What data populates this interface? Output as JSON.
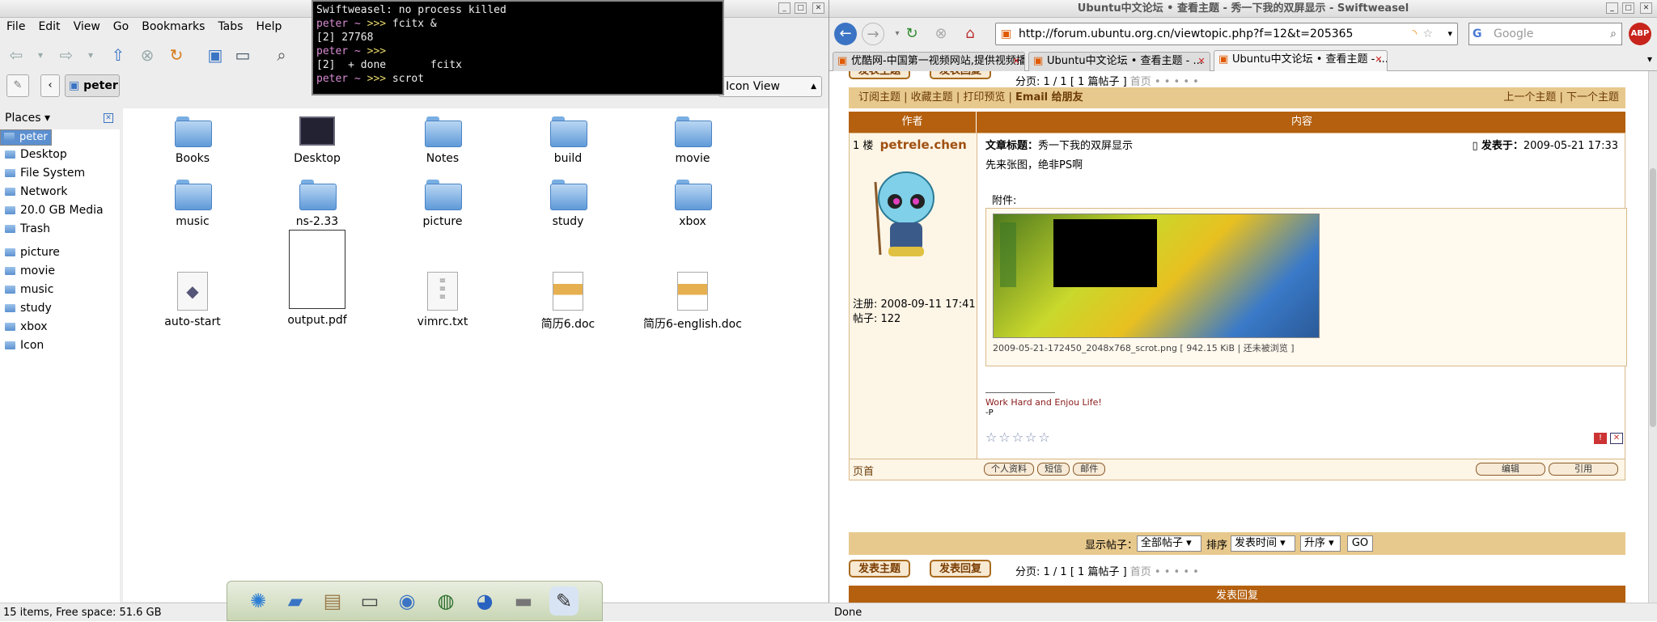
{
  "file_manager": {
    "menu": [
      "File",
      "Edit",
      "View",
      "Go",
      "Bookmarks",
      "Tabs",
      "Help"
    ],
    "location": "peter",
    "view_mode": "Icon View",
    "places_label": "Places",
    "places": [
      {
        "label": "peter",
        "selected": true
      },
      {
        "label": "Desktop"
      },
      {
        "label": "File System"
      },
      {
        "label": "Network"
      },
      {
        "label": "20.0 GB Media"
      },
      {
        "label": "Trash"
      }
    ],
    "bookmarks": [
      "picture",
      "movie",
      "music",
      "study",
      "xbox",
      "Icon"
    ],
    "items": [
      {
        "name": "Books",
        "type": "folder"
      },
      {
        "name": "Desktop",
        "type": "desktop"
      },
      {
        "name": "Notes",
        "type": "folder"
      },
      {
        "name": "build",
        "type": "folder"
      },
      {
        "name": "movie",
        "type": "folder"
      },
      {
        "name": "music",
        "type": "folder"
      },
      {
        "name": "ns-2.33",
        "type": "folder"
      },
      {
        "name": "picture",
        "type": "folder"
      },
      {
        "name": "study",
        "type": "folder"
      },
      {
        "name": "xbox",
        "type": "folder"
      },
      {
        "name": "auto-start",
        "type": "script"
      },
      {
        "name": "output.pdf",
        "type": "pdf"
      },
      {
        "name": "vimrc.txt",
        "type": "text"
      },
      {
        "name": "简历6.doc",
        "type": "doc"
      },
      {
        "name": "简历6-english.doc",
        "type": "doc"
      }
    ],
    "status": "15 items, Free space: 51.6 GB"
  },
  "terminal": {
    "lines": [
      {
        "text": "Swiftweasel: no process killed"
      },
      {
        "prompt": "peter ~ ",
        "arrows": ">>>",
        "cmd": " fcitx &"
      },
      {
        "text": "[2] 27768"
      },
      {
        "prompt": "peter ~ ",
        "arrows": ">>>",
        "cmd": ""
      },
      {
        "text": "[2]  + done       fcitx"
      },
      {
        "prompt": "peter ~ ",
        "arrows": ">>>",
        "cmd": " scrot"
      }
    ]
  },
  "browser": {
    "title": "Ubuntu中文论坛 • 查看主题 - 秀一下我的双屏显示 - Swiftweasel",
    "url": "http://forum.ubuntu.org.cn/viewtopic.php?f=12&t=205365",
    "search_placeholder": "Google",
    "tabs": [
      {
        "label": "优酷网-中国第一视频网站,提供视频播..."
      },
      {
        "label": "Ubuntu中文论坛 • 查看主题 - ..."
      },
      {
        "label": "Ubuntu中文论坛 • 查看主题 - ...",
        "active": true
      }
    ],
    "status": "Done",
    "forum": {
      "new_topic": "发表主题",
      "reply": "发表回复",
      "pagination": "分页: 1 / 1 [ 1 篇帖子 ]",
      "first_page": "首页",
      "topic_links": [
        "订阅主题",
        "收藏主题",
        "打印预览",
        "Email 给朋友"
      ],
      "prev_topic": "上一个主题",
      "next_topic": "下一个主题",
      "col_author": "作者",
      "col_content": "内容",
      "floor": "1 楼",
      "author": "petrele.chen",
      "subject_label": "文章标题：",
      "subject": "秀一下我的双屏显示",
      "posted_label": "发表于：",
      "posted": "2009-05-21 17:33",
      "body": "先来张图，绝非PS啊",
      "attachment_label": "附件:",
      "attachment_caption": "2009-05-21-172450_2048x768_scrot.png [ 942.15 KiB | 还未被浏览 ]",
      "signature": "Work Hard and Enjou Life!",
      "sig_tail": "-P",
      "registered": "注册: 2008-09-11 17:41",
      "posts": "帖子: 122",
      "top_link": "页首",
      "post_buttons": [
        "个人资料",
        "短信",
        "邮件"
      ],
      "edit_buttons": [
        "编辑",
        "引用"
      ],
      "display_label": "显示帖子：",
      "display_value": "全部帖子",
      "sort_label": "排序",
      "sort_value": "发表时间",
      "order_value": "升序",
      "go": "GO",
      "pagination2": "分页: 1 / 1 [ 1 篇帖子 ]",
      "bottom_bar": "发表回复"
    }
  },
  "dock": [
    "dash",
    "files",
    "photos",
    "terminal",
    "network",
    "browser",
    "globe",
    "drive",
    "editor"
  ]
}
